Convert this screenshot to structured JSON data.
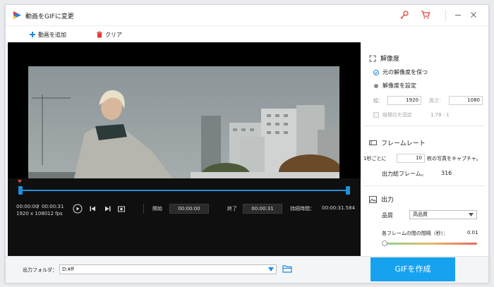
{
  "window": {
    "title": "動画をGIFに変更"
  },
  "toolbar": {
    "add_label": "動画を追加",
    "clear_label": "クリア"
  },
  "colors": {
    "accent": "#17a2f0",
    "danger": "#e0443c",
    "timeline": "#1e8fd8"
  },
  "timeline": {
    "current_time": "00:00:00",
    "separator": "/",
    "total_time": "00:00:31",
    "resolution": "1920 x 1080",
    "fps": "12 fps",
    "start_label": "開始",
    "start_value": "00:00:00",
    "end_label": "終了",
    "end_value": "00:00:31",
    "duration_label": "持続時間：",
    "duration_value": "00:00:31.584"
  },
  "bottom": {
    "folder_label": "出力フォルダ：",
    "folder_value": "D:¥ff",
    "create_label": "GIFを作成"
  },
  "settings": {
    "resolution_title": "解像度",
    "keep_original": "元の解像度を保つ",
    "set_resolution": "解像度を設定",
    "width_label": "幅：",
    "width_value": "1920",
    "height_label": "高さ：",
    "height_value": "1080",
    "aspect_label": "縦横比を固定",
    "aspect_value": "1.78 : 1",
    "frame_title": "フレームレート",
    "per_sec_label": "1秒ごとに",
    "per_sec_value": "10",
    "per_sec_suffix": "枚の写真をキャプチャ。",
    "total_frames_label": "出力総フレーム。",
    "total_frames_value": "316",
    "output_title": "出力",
    "quality_label": "品質",
    "quality_value": "高品質",
    "interval_label": "各フレームの間の間隔（秒）：",
    "interval_value": "0.01"
  }
}
